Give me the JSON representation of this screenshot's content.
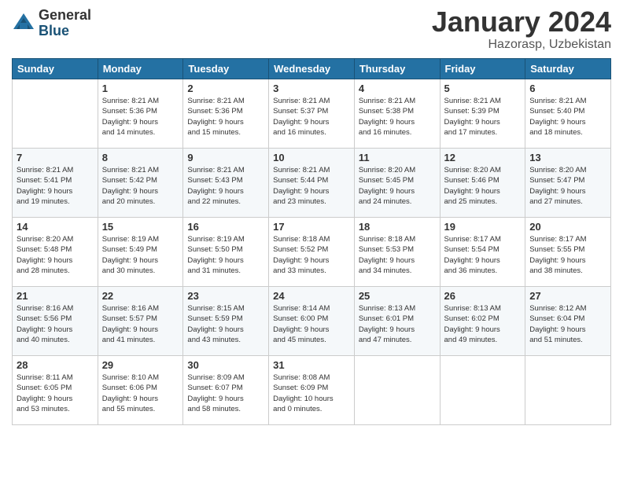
{
  "header": {
    "logo": {
      "line1": "General",
      "line2": "Blue"
    },
    "title": "January 2024",
    "location": "Hazorasp, Uzbekistan"
  },
  "days_of_week": [
    "Sunday",
    "Monday",
    "Tuesday",
    "Wednesday",
    "Thursday",
    "Friday",
    "Saturday"
  ],
  "weeks": [
    [
      {
        "day": "",
        "info": ""
      },
      {
        "day": "1",
        "info": "Sunrise: 8:21 AM\nSunset: 5:36 PM\nDaylight: 9 hours\nand 14 minutes."
      },
      {
        "day": "2",
        "info": "Sunrise: 8:21 AM\nSunset: 5:36 PM\nDaylight: 9 hours\nand 15 minutes."
      },
      {
        "day": "3",
        "info": "Sunrise: 8:21 AM\nSunset: 5:37 PM\nDaylight: 9 hours\nand 16 minutes."
      },
      {
        "day": "4",
        "info": "Sunrise: 8:21 AM\nSunset: 5:38 PM\nDaylight: 9 hours\nand 16 minutes."
      },
      {
        "day": "5",
        "info": "Sunrise: 8:21 AM\nSunset: 5:39 PM\nDaylight: 9 hours\nand 17 minutes."
      },
      {
        "day": "6",
        "info": "Sunrise: 8:21 AM\nSunset: 5:40 PM\nDaylight: 9 hours\nand 18 minutes."
      }
    ],
    [
      {
        "day": "7",
        "info": "Sunrise: 8:21 AM\nSunset: 5:41 PM\nDaylight: 9 hours\nand 19 minutes."
      },
      {
        "day": "8",
        "info": "Sunrise: 8:21 AM\nSunset: 5:42 PM\nDaylight: 9 hours\nand 20 minutes."
      },
      {
        "day": "9",
        "info": "Sunrise: 8:21 AM\nSunset: 5:43 PM\nDaylight: 9 hours\nand 22 minutes."
      },
      {
        "day": "10",
        "info": "Sunrise: 8:21 AM\nSunset: 5:44 PM\nDaylight: 9 hours\nand 23 minutes."
      },
      {
        "day": "11",
        "info": "Sunrise: 8:20 AM\nSunset: 5:45 PM\nDaylight: 9 hours\nand 24 minutes."
      },
      {
        "day": "12",
        "info": "Sunrise: 8:20 AM\nSunset: 5:46 PM\nDaylight: 9 hours\nand 25 minutes."
      },
      {
        "day": "13",
        "info": "Sunrise: 8:20 AM\nSunset: 5:47 PM\nDaylight: 9 hours\nand 27 minutes."
      }
    ],
    [
      {
        "day": "14",
        "info": "Sunrise: 8:20 AM\nSunset: 5:48 PM\nDaylight: 9 hours\nand 28 minutes."
      },
      {
        "day": "15",
        "info": "Sunrise: 8:19 AM\nSunset: 5:49 PM\nDaylight: 9 hours\nand 30 minutes."
      },
      {
        "day": "16",
        "info": "Sunrise: 8:19 AM\nSunset: 5:50 PM\nDaylight: 9 hours\nand 31 minutes."
      },
      {
        "day": "17",
        "info": "Sunrise: 8:18 AM\nSunset: 5:52 PM\nDaylight: 9 hours\nand 33 minutes."
      },
      {
        "day": "18",
        "info": "Sunrise: 8:18 AM\nSunset: 5:53 PM\nDaylight: 9 hours\nand 34 minutes."
      },
      {
        "day": "19",
        "info": "Sunrise: 8:17 AM\nSunset: 5:54 PM\nDaylight: 9 hours\nand 36 minutes."
      },
      {
        "day": "20",
        "info": "Sunrise: 8:17 AM\nSunset: 5:55 PM\nDaylight: 9 hours\nand 38 minutes."
      }
    ],
    [
      {
        "day": "21",
        "info": "Sunrise: 8:16 AM\nSunset: 5:56 PM\nDaylight: 9 hours\nand 40 minutes."
      },
      {
        "day": "22",
        "info": "Sunrise: 8:16 AM\nSunset: 5:57 PM\nDaylight: 9 hours\nand 41 minutes."
      },
      {
        "day": "23",
        "info": "Sunrise: 8:15 AM\nSunset: 5:59 PM\nDaylight: 9 hours\nand 43 minutes."
      },
      {
        "day": "24",
        "info": "Sunrise: 8:14 AM\nSunset: 6:00 PM\nDaylight: 9 hours\nand 45 minutes."
      },
      {
        "day": "25",
        "info": "Sunrise: 8:13 AM\nSunset: 6:01 PM\nDaylight: 9 hours\nand 47 minutes."
      },
      {
        "day": "26",
        "info": "Sunrise: 8:13 AM\nSunset: 6:02 PM\nDaylight: 9 hours\nand 49 minutes."
      },
      {
        "day": "27",
        "info": "Sunrise: 8:12 AM\nSunset: 6:04 PM\nDaylight: 9 hours\nand 51 minutes."
      }
    ],
    [
      {
        "day": "28",
        "info": "Sunrise: 8:11 AM\nSunset: 6:05 PM\nDaylight: 9 hours\nand 53 minutes."
      },
      {
        "day": "29",
        "info": "Sunrise: 8:10 AM\nSunset: 6:06 PM\nDaylight: 9 hours\nand 55 minutes."
      },
      {
        "day": "30",
        "info": "Sunrise: 8:09 AM\nSunset: 6:07 PM\nDaylight: 9 hours\nand 58 minutes."
      },
      {
        "day": "31",
        "info": "Sunrise: 8:08 AM\nSunset: 6:09 PM\nDaylight: 10 hours\nand 0 minutes."
      },
      {
        "day": "",
        "info": ""
      },
      {
        "day": "",
        "info": ""
      },
      {
        "day": "",
        "info": ""
      }
    ]
  ]
}
